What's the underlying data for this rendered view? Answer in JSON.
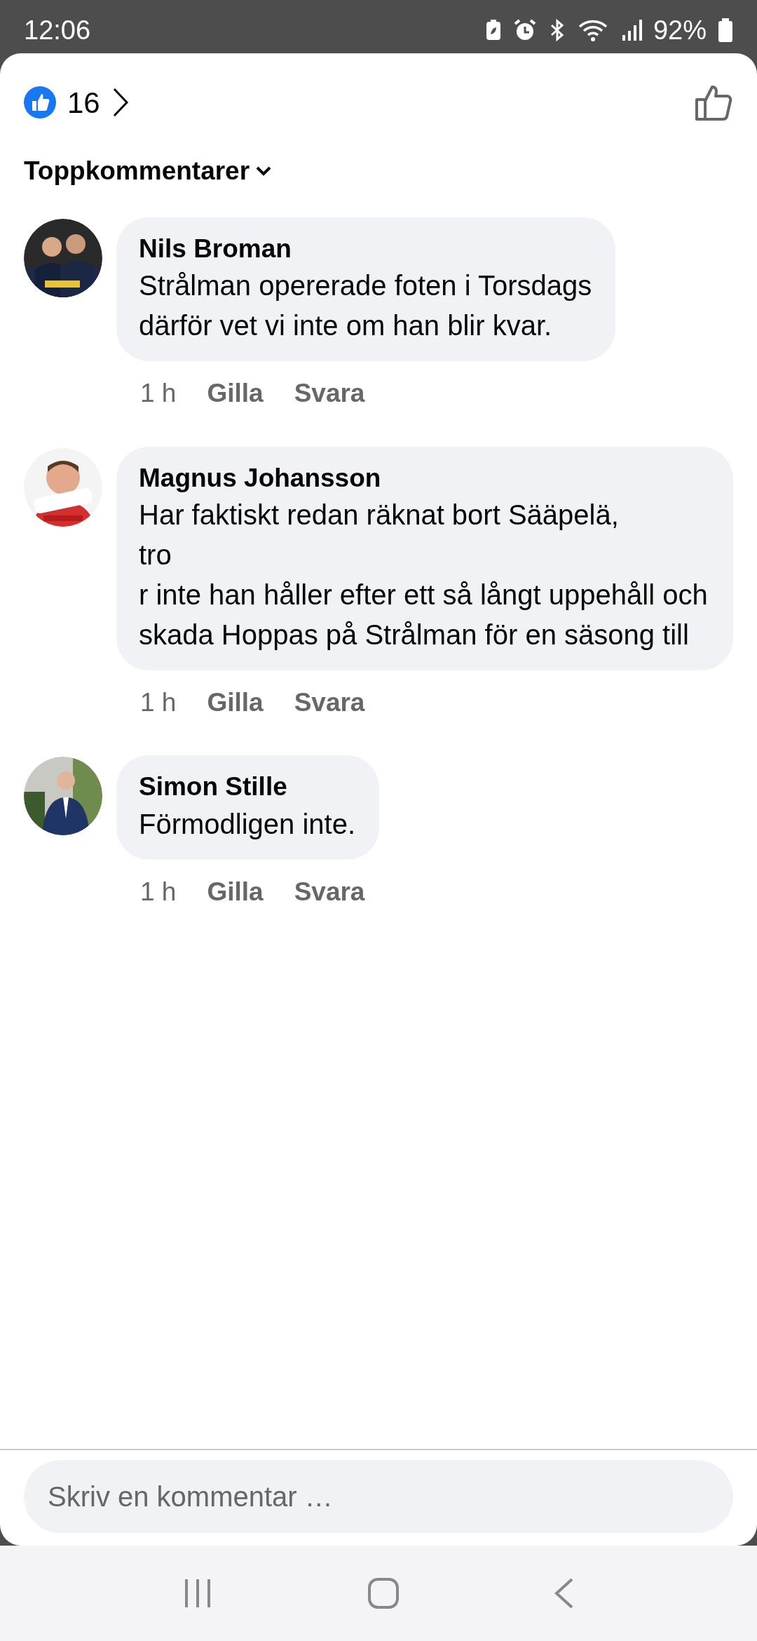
{
  "status_bar": {
    "time": "12:06",
    "battery": "92%"
  },
  "header": {
    "like_count": "16"
  },
  "sort": {
    "label": "Toppkommentarer"
  },
  "comments": [
    {
      "author": "Nils Broman",
      "text": "Strålman opererade foten i Torsdags\ndärför vet vi inte om han blir kvar.",
      "time": "1 h",
      "like": "Gilla",
      "reply": "Svara"
    },
    {
      "author": "Magnus Johansson",
      "text": "Har faktiskt redan räknat bort Sääpelä,\ntro\nr inte han håller efter ett så långt uppehåll och skada Hoppas på Strålman för en säsong till",
      "time": "1 h",
      "like": "Gilla",
      "reply": "Svara"
    },
    {
      "author": "Simon Stille",
      "text": "Förmodligen inte.",
      "time": "1 h",
      "like": "Gilla",
      "reply": "Svara"
    }
  ],
  "composer": {
    "placeholder": "Skriv en kommentar …"
  }
}
